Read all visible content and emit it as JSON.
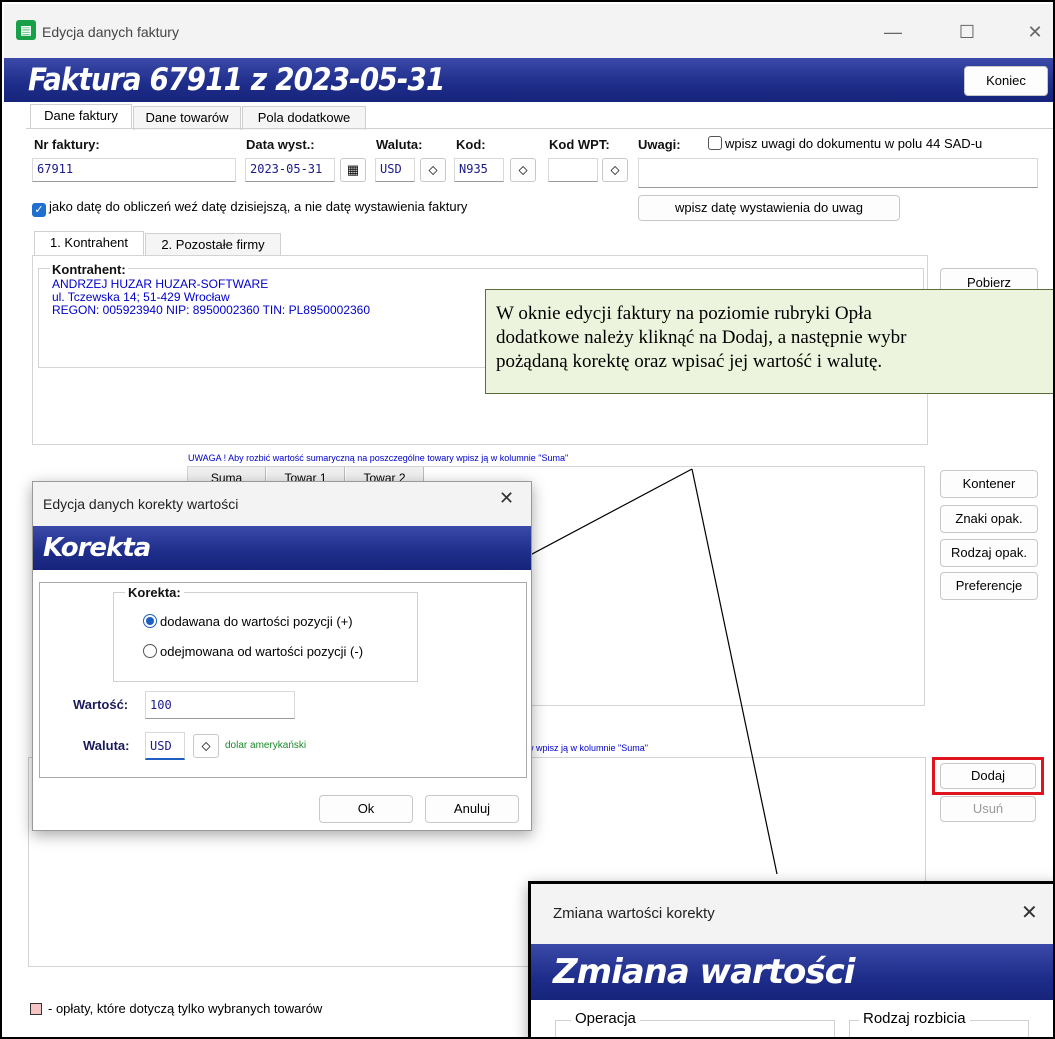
{
  "window": {
    "title": "Edycja danych faktury",
    "minimize": "—",
    "maximize": "☐",
    "close": "✕"
  },
  "banner": {
    "title": "Faktura 67911 z 2023-05-31",
    "close_label": "Koniec"
  },
  "main_tabs": [
    "Dane faktury",
    "Dane towarów",
    "Pola dodatkowe"
  ],
  "fields": {
    "nr_label": "Nr faktury:",
    "nr_value": "67911",
    "data_label": "Data wyst.:",
    "data_value": "2023-05-31",
    "waluta_label": "Waluta:",
    "waluta_value": "USD",
    "kod_label": "Kod:",
    "kod_value": "N935",
    "wpt_label": "Kod WPT:",
    "wpt_value": "",
    "uwagi_label": "Uwagi:",
    "uwagi_value": "",
    "uwagi_check": "wpisz uwagi do dokumentu w polu 44 SAD-u"
  },
  "date_check": "jako datę do obliczeń weź datę dzisiejszą, a nie datę wystawienia faktury",
  "date_button": "wpisz datę wystawienia do uwag",
  "sub_tabs": [
    "1. Kontrahent",
    "2. Pozostałe firmy"
  ],
  "contractor": {
    "heading": "Kontrahent:",
    "lines": [
      "ANDRZEJ HUZAR HUZAR-SOFTWARE",
      "ul. Tczewska 14; 51-429 Wrocław",
      "REGON: 005923940  NIP: 8950002360  TIN: PL8950002360"
    ],
    "fetch_button": "Pobierz"
  },
  "warning_top": "UWAGA ! Aby rozbić wartość sumaryczną na poszczególne towary wpisz ją w kolumnie \"Suma\"",
  "warning_bottom": "ów wpisz ją w kolumnie \"Suma\"",
  "grid_headers": [
    "Suma",
    "Towar 1",
    "Towar 2"
  ],
  "side_buttons": [
    "Kontener",
    "Znaki opak.",
    "Rodzaj opak.",
    "Preferencje"
  ],
  "fee_buttons": {
    "add": "Dodaj",
    "remove": "Usuń"
  },
  "legend": "- opłaty, które dotyczą tylko wybranych towarów",
  "callout": {
    "line1": "W oknie edycji faktury na poziomie rubryki Opła",
    "line2": "dodatkowe należy kliknąć na Dodaj, a następnie wybr",
    "line3": "pożądaną korektę oraz wpisać jej wartość i walutę."
  },
  "dialog1": {
    "title": "Edycja danych korekty wartości",
    "banner": "Korekta",
    "group": "Korekta:",
    "options": [
      "dodawana do wartości pozycji (+)",
      "odejmowana od wartości pozycji (-)"
    ],
    "selected": 0,
    "value_label": "Wartość:",
    "value": "100",
    "currency_label": "Waluta:",
    "currency": "USD",
    "currency_name": "dolar amerykański",
    "ok": "Ok",
    "cancel": "Anuluj"
  },
  "dialog2": {
    "title": "Zmiana wartości korekty",
    "banner": "Zmiana wartości",
    "group_left": "Operacja",
    "group_right": "Rodzaj rozbicia"
  },
  "colors": {
    "banner": "#1e2d8a",
    "callout_bg": "#ecf4dd",
    "highlight": "#e0141e",
    "blue_text": "#0000cc"
  }
}
